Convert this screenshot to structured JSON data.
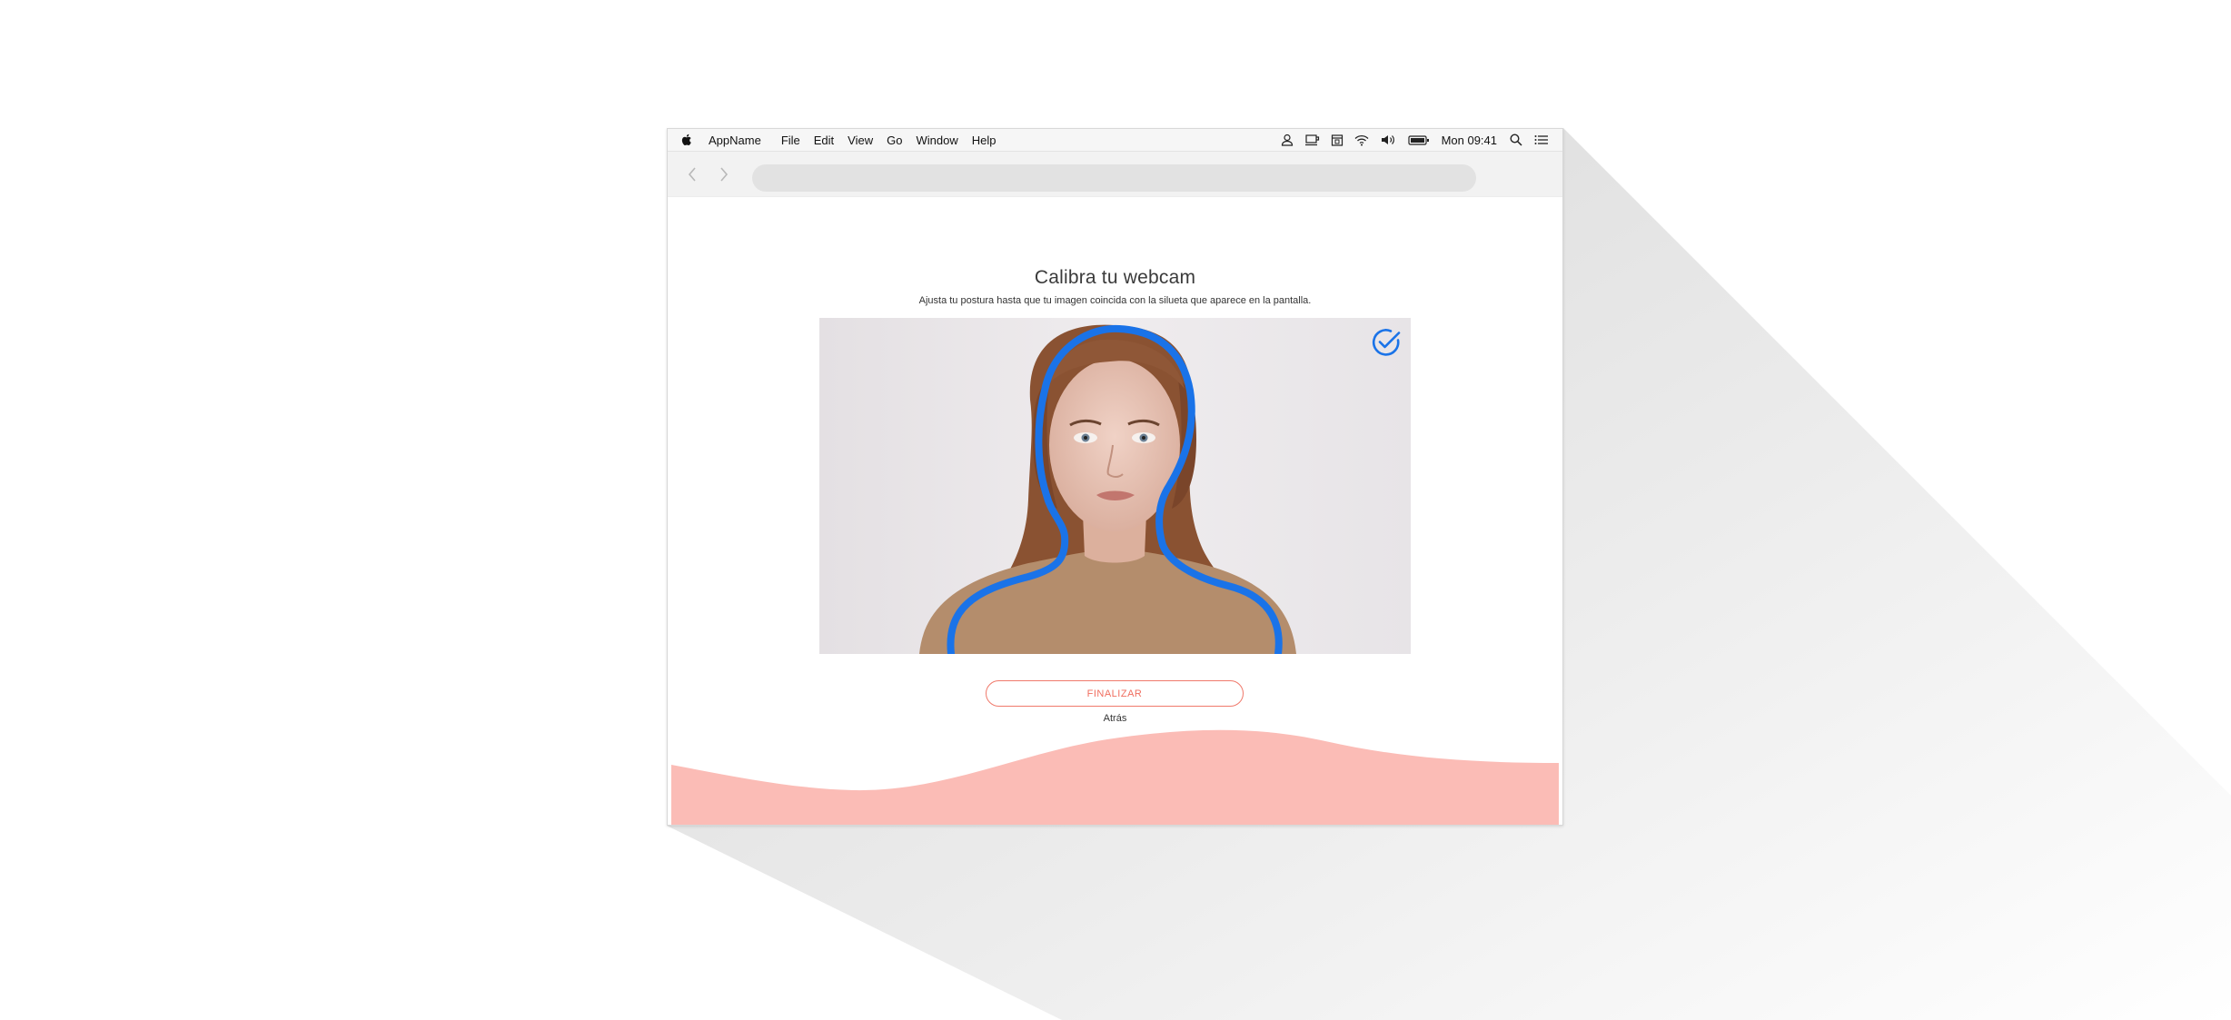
{
  "menubar": {
    "app_name": "AppName",
    "items": [
      "File",
      "Edit",
      "View",
      "Go",
      "Window",
      "Help"
    ],
    "clock": "Mon 09:41",
    "status_icons": [
      "user-icon",
      "cup-icon",
      "calendar-icon",
      "wifi-icon",
      "volume-icon",
      "battery-icon",
      "search-icon",
      "list-icon"
    ]
  },
  "toolbar": {
    "back_icon": "chevron-left-icon",
    "forward_icon": "chevron-right-icon",
    "url": ""
  },
  "page": {
    "title": "Calibra tu webcam",
    "subtitle": "Ajusta tu postura hasta que tu imagen coincida con la silueta que aparece en la pantalla.",
    "finish_label": "FINALIZAR",
    "back_label": "Atrás"
  },
  "colors": {
    "accent_blue": "#1a73e8",
    "accent_coral": "#f06e5f",
    "wave_pink": "#fbbcb6"
  }
}
